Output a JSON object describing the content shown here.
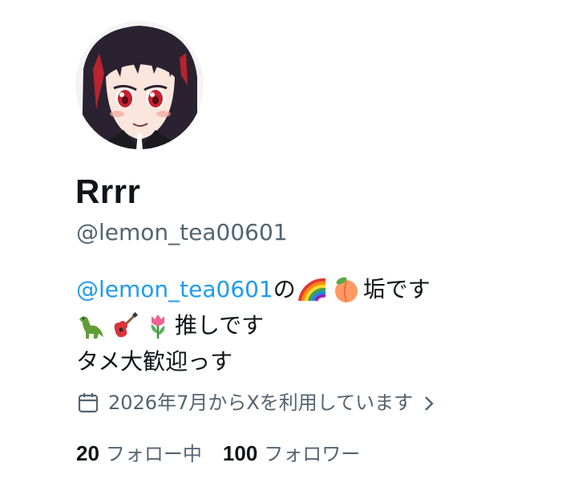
{
  "profile": {
    "display_name": "Rrrr",
    "handle": "@lemon_tea00601",
    "bio": {
      "line1_mention": "@lemon_tea0601",
      "line1_mid": "の",
      "line1_emojis": [
        "rainbow-emoji",
        "peach-emoji"
      ],
      "line1_end": "垢です",
      "line2_emojis": [
        "dinosaur-emoji",
        "guitar-emoji",
        "tulip-emoji"
      ],
      "line2_end": "推しです",
      "line3": "タメ大歓迎っす"
    },
    "joined": {
      "icon": "calendar-icon",
      "text": "2026年7月からXを利用しています",
      "chevron": "chevron-right-icon"
    },
    "stats": {
      "following_count": "20",
      "following_label": "フォロー中",
      "followers_count": "100",
      "followers_label": "フォロワー"
    }
  },
  "colors": {
    "link": "#1d9bf0",
    "secondary_text": "#536471",
    "primary_text": "#0f1419",
    "background": "#ffffff"
  }
}
